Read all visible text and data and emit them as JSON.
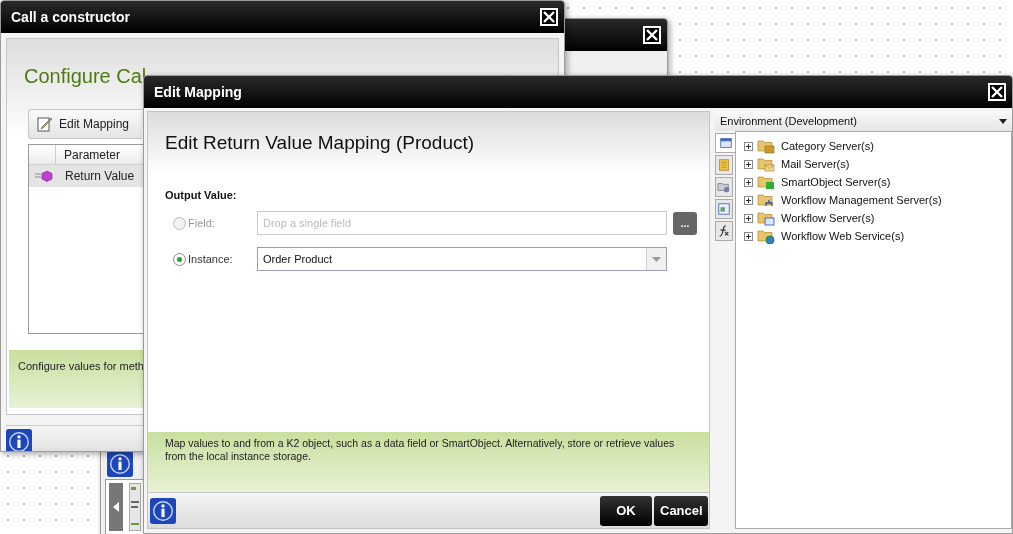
{
  "constructor_window": {
    "title": "Call a constructor",
    "heading": "Configure Cal",
    "toolbar_button": "Edit Mapping",
    "table": {
      "columns": [
        "Parameter"
      ],
      "rows": [
        {
          "parameter": "Return Value",
          "selected": true
        }
      ]
    },
    "info": "Configure values for meth"
  },
  "mapping_window": {
    "title": "Edit Mapping",
    "heading": "Edit Return Value Mapping (Product)",
    "section_label": "Output Value:",
    "options": [
      {
        "kind": "field",
        "label": "Field:",
        "selected": false,
        "disabled": true,
        "placeholder": "Drop a single field",
        "button": "..."
      },
      {
        "kind": "instance",
        "label": "Instance:",
        "selected": true,
        "disabled": false,
        "value": "Order Product"
      }
    ],
    "info": "Map values to and from a K2 object, such as a data field or SmartObject. Alternatively, store or retrieve values from the local instance storage.",
    "buttons": [
      "OK",
      "Cancel"
    ],
    "environment": {
      "title": "Environment (Development)",
      "side_tabs": [
        {
          "kind": "environment",
          "selected": true
        },
        {
          "kind": "context",
          "selected": false
        },
        {
          "kind": "objects",
          "selected": false
        },
        {
          "kind": "variables",
          "selected": false
        },
        {
          "kind": "functions",
          "selected": false
        }
      ],
      "tree": [
        {
          "kind": "category",
          "label": "Category Server(s)",
          "expanded": false
        },
        {
          "kind": "mail",
          "label": "Mail Server(s)",
          "expanded": false
        },
        {
          "kind": "smartobject",
          "label": "SmartObject Server(s)",
          "expanded": false
        },
        {
          "kind": "management",
          "label": "Workflow Management Server(s)",
          "expanded": false
        },
        {
          "kind": "workflow",
          "label": "Workflow Server(s)",
          "expanded": false
        },
        {
          "kind": "webservice",
          "label": "Workflow Web Service(s)",
          "expanded": false
        }
      ]
    }
  }
}
